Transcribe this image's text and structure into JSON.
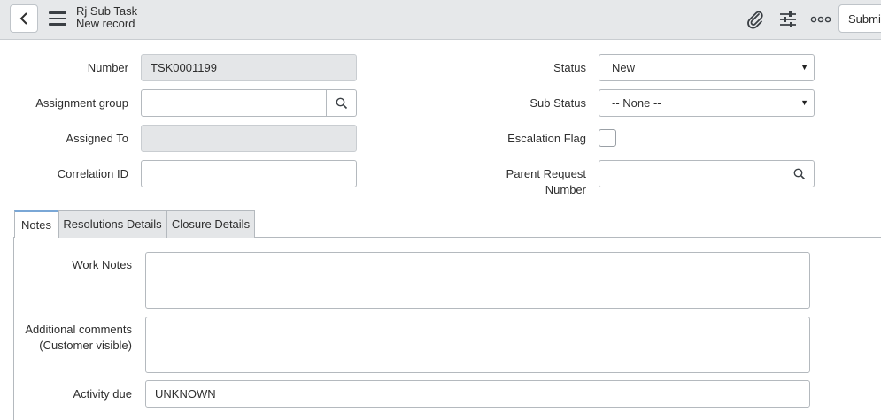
{
  "header": {
    "title": "Rj Sub Task",
    "subtitle": "New record",
    "submit_label": "Submit",
    "icons": [
      "back-icon",
      "hamburger-icon",
      "paperclip-icon",
      "sliders-icon",
      "more-icon"
    ]
  },
  "form": {
    "number": {
      "label": "Number",
      "value": "TSK0001199"
    },
    "assignment_group": {
      "label": "Assignment group",
      "value": ""
    },
    "assigned_to": {
      "label": "Assigned To",
      "value": ""
    },
    "correlation_id": {
      "label": "Correlation ID",
      "value": ""
    },
    "status": {
      "label": "Status",
      "value": "New"
    },
    "sub_status": {
      "label": "Sub Status",
      "value": "-- None --"
    },
    "escalation_flag": {
      "label": "Escalation Flag",
      "checked": false
    },
    "parent_request": {
      "label_line1": "Parent Request",
      "label_line2": "Number",
      "value": ""
    }
  },
  "tabs": [
    {
      "label": "Notes",
      "active": true
    },
    {
      "label": "Resolutions Details",
      "active": false
    },
    {
      "label": "Closure Details",
      "active": false
    }
  ],
  "notes": {
    "work_notes_label": "Work Notes",
    "additional_comments_line1": "Additional comments",
    "additional_comments_line2": "(Customer visible)",
    "activity_due_label": "Activity due",
    "activity_due_value": "UNKNOWN"
  },
  "colors": {
    "header_bg": "#e6e8ea",
    "readonly_bg": "#e4e6e8",
    "active_tab_accent": "#7aa7d6"
  }
}
